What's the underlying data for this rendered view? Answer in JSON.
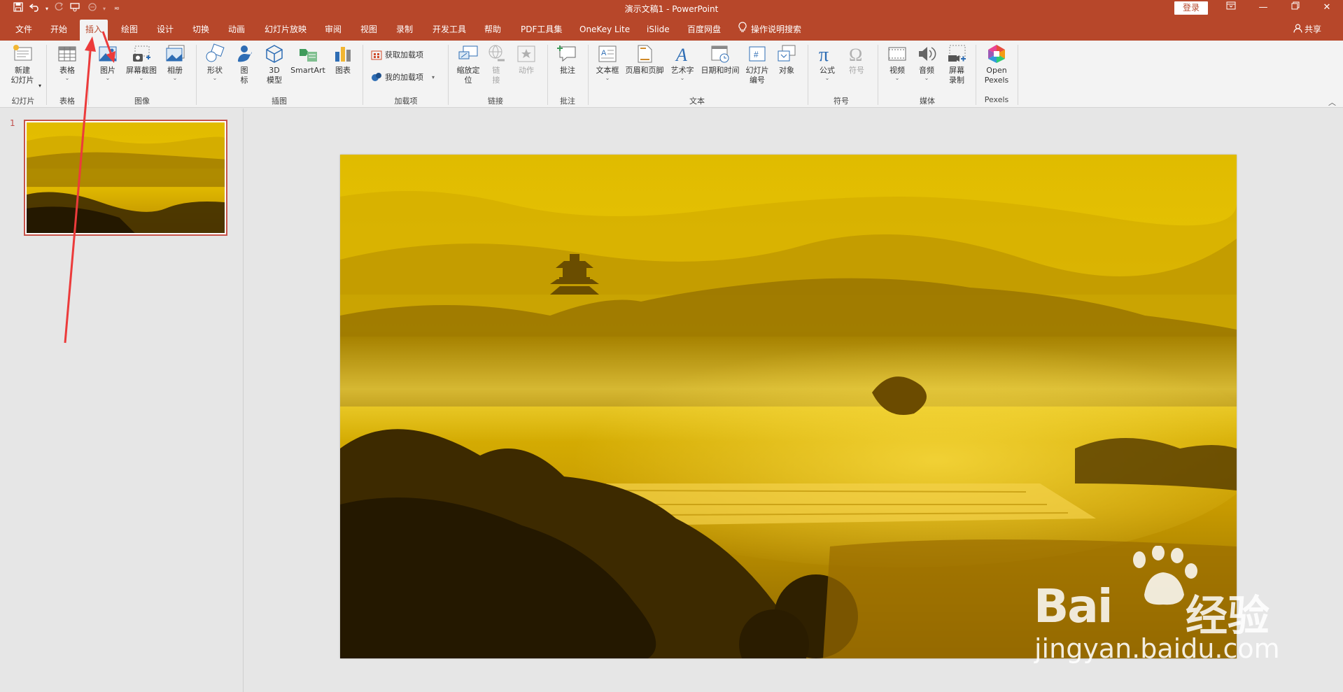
{
  "window": {
    "title": "演示文稿1  -  PowerPoint",
    "login_label": "登录",
    "qat_icons": [
      "save-icon",
      "undo-icon",
      "redo-icon",
      "touch-mode-icon",
      "format-painter-icon",
      "customize-qat-icon"
    ]
  },
  "tabs": [
    {
      "label": "文件"
    },
    {
      "label": "开始"
    },
    {
      "label": "插入"
    },
    {
      "label": "绘图"
    },
    {
      "label": "设计"
    },
    {
      "label": "切换"
    },
    {
      "label": "动画"
    },
    {
      "label": "幻灯片放映"
    },
    {
      "label": "审阅"
    },
    {
      "label": "视图"
    },
    {
      "label": "录制"
    },
    {
      "label": "开发工具"
    },
    {
      "label": "帮助"
    },
    {
      "label": "PDF工具集"
    },
    {
      "label": "OneKey Lite"
    },
    {
      "label": "iSlide"
    },
    {
      "label": "百度网盘"
    }
  ],
  "search_label": "操作说明搜索",
  "share_label": "共享",
  "ribbon": {
    "new_slide": "新建\n幻灯片",
    "table": "表格",
    "picture": "图片",
    "screenshot": "屏幕截图",
    "album": "相册",
    "shapes": "形状",
    "icons": "图\n标",
    "model3d": "3D\n模型",
    "smartart": "SmartArt",
    "chart": "图表",
    "get_addins": "获取加载项",
    "my_addins": "我的加载项",
    "zoom": "缩放定\n位",
    "link": "链\n接",
    "action": "动作",
    "comment": "批注",
    "textbox": "文本框",
    "header_footer": "页眉和页脚",
    "wordart": "艺术字",
    "datetime": "日期和时间",
    "slide_number": "幻灯片\n编号",
    "object": "对象",
    "equation": "公式",
    "symbol": "符号",
    "video": "视频",
    "audio": "音频",
    "screen_recording": "屏幕\n录制",
    "open_pexels": "Open\nPexels",
    "groups": {
      "slides": "幻灯片",
      "tables": "表格",
      "images": "图像",
      "illustrations": "插图",
      "addins": "加载项",
      "links": "链接",
      "comments": "批注",
      "text": "文本",
      "symbols": "符号",
      "media": "媒体",
      "pexels": "Pexels"
    }
  },
  "slides_pane": {
    "slide_number": "1"
  },
  "watermark": {
    "brand": "Bai",
    "brand_cn": "经验",
    "url": "jingyan.baidu.com"
  },
  "colors": {
    "accent": "#b7472a",
    "annotation_arrow": "#ec3b3b"
  }
}
